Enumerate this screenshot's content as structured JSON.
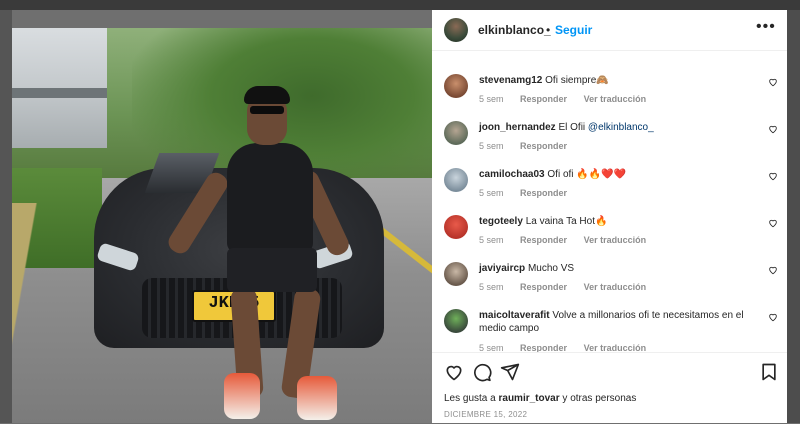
{
  "post": {
    "username": "elkinblanco_",
    "separator": "•",
    "follow_label": "Seguir",
    "more_label": "•••",
    "plate_text": "JKN-5",
    "likes_prefix": "Les gusta a",
    "likes_user": "raumir_tovar",
    "likes_suffix": "y otras personas",
    "date": "DICIEMBRE 15, 2022"
  },
  "comments": [
    {
      "user": "stevenamg12",
      "text": "Ofi siempre🙈",
      "mention": "",
      "time": "5 sem",
      "actions": [
        "Responder",
        "Ver traducción"
      ],
      "avatar_color": "#7a4a34"
    },
    {
      "user": "joon_hernandez",
      "text": "El Ofii",
      "mention": "@elkinblanco_",
      "time": "5 sem",
      "actions": [
        "Responder"
      ],
      "avatar_color": "#5e6b5a"
    },
    {
      "user": "camilochaa03",
      "text": "Ofi ofi 🔥🔥❤️❤️",
      "mention": "",
      "time": "5 sem",
      "actions": [
        "Responder"
      ],
      "avatar_color": "#7c8e9c"
    },
    {
      "user": "tegoteely",
      "text": "La vaina Ta Hot🔥",
      "mention": "",
      "time": "5 sem",
      "actions": [
        "Responder",
        "Ver traducción"
      ],
      "avatar_color": "#b8342a"
    },
    {
      "user": "javiyaircp",
      "text": "Mucho VS",
      "mention": "",
      "time": "5 sem",
      "actions": [
        "Responder",
        "Ver traducción"
      ],
      "avatar_color": "#6a5a4d"
    },
    {
      "user": "maicoltaverafit",
      "text": "Volve a millonarios ofi te necesitamos en el medio campo",
      "mention": "",
      "time": "5 sem",
      "actions": [
        "Responder",
        "Ver traducción"
      ],
      "avatar_color": "#3a4a3c"
    }
  ],
  "icons": {
    "like": "heart-icon",
    "comment": "comment-icon",
    "share": "send-icon",
    "save": "bookmark-icon",
    "more": "more-icon"
  },
  "colors": {
    "follow": "#0095f6",
    "text": "#262626",
    "meta": "#8e8e8e"
  }
}
